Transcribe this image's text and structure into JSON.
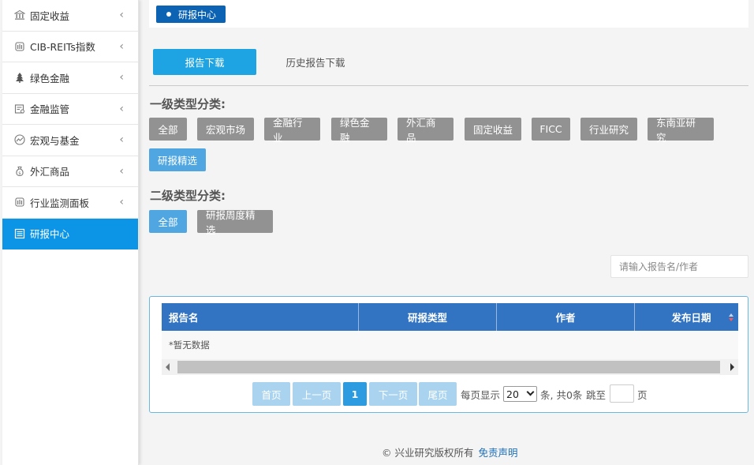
{
  "sidebar": {
    "items": [
      {
        "label": "固定收益",
        "icon": "bank-icon"
      },
      {
        "label": "CIB-REITs指数",
        "icon": "building-icon"
      },
      {
        "label": "绿色金融",
        "icon": "tree-icon"
      },
      {
        "label": "金融监管",
        "icon": "regulation-icon"
      },
      {
        "label": "宏观与基金",
        "icon": "trend-icon"
      },
      {
        "label": "外汇商品",
        "icon": "money-bag-icon"
      },
      {
        "label": "行业监测面板",
        "icon": "building-icon"
      },
      {
        "label": "研报中心",
        "icon": "report-icon",
        "active": true
      }
    ]
  },
  "breadcrumb": {
    "label": "研报中心"
  },
  "tabs": {
    "primary": "报告下载",
    "secondary": "历史报告下载"
  },
  "level1": {
    "title": "一级类型分类:",
    "chips": [
      "全部",
      "宏观市场",
      "金融行业",
      "绿色金融",
      "外汇商品",
      "固定收益",
      "FICC",
      "行业研究",
      "东南亚研究",
      "研报精选"
    ]
  },
  "level2": {
    "title": "二级类型分类:",
    "chips": [
      "全部",
      "研报周度精选"
    ]
  },
  "search": {
    "placeholder": "请输入报告名/作者"
  },
  "table": {
    "columns": [
      "报告名",
      "研报类型",
      "作者",
      "发布日期"
    ],
    "empty_text": "*暂无数据"
  },
  "pagination": {
    "first": "首页",
    "prev": "上一页",
    "current": "1",
    "next": "下一页",
    "last": "尾页",
    "per_page_label": "每页显示",
    "per_page_value": "20",
    "total_text": "条, 共0条",
    "jump_label": "跳至",
    "page_suffix": "页"
  },
  "footer": {
    "copyright": "© 兴业研究版权所有",
    "disclaimer": "免责声明"
  },
  "colors": {
    "active_sidebar": "#0c95e6",
    "breadcrumb": "#0c63b3",
    "tab_primary": "#1ea4e3",
    "table_header": "#3274c2",
    "chip_default": "#929292",
    "chip_selected": "#4fa6e0"
  }
}
